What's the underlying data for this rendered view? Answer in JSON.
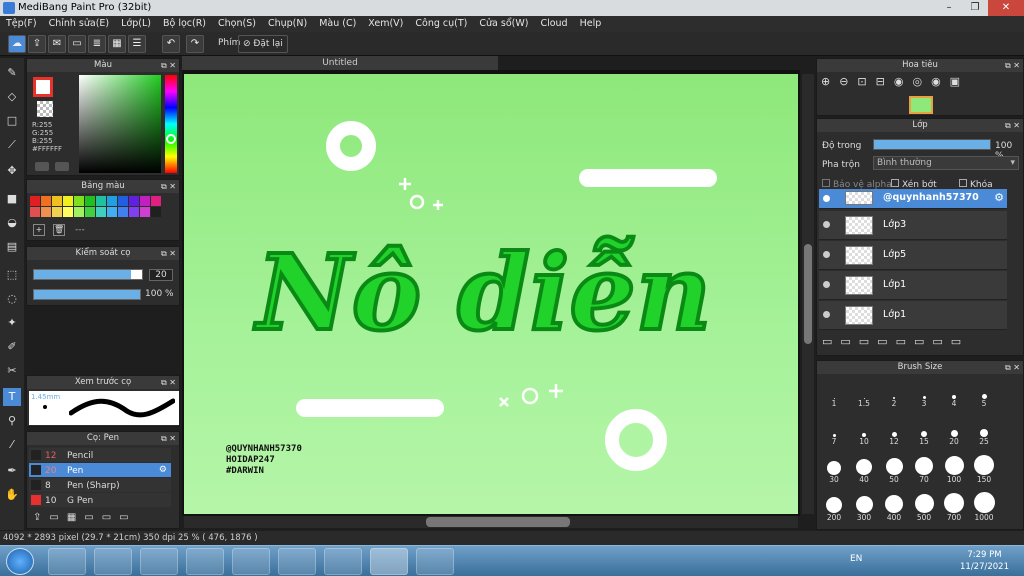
{
  "app": {
    "title": "MediBang Paint Pro (32bit)"
  },
  "window": {
    "min": "–",
    "max": "❐",
    "close": "✕"
  },
  "menu": [
    "Tệp(F)",
    "Chỉnh sửa(E)",
    "Lớp(L)",
    "Bộ lọc(R)",
    "Chọn(S)",
    "Chụp(N)",
    "Màu (C)",
    "Xem(V)",
    "Công cụ(T)",
    "Cửa sổ(W)",
    "Cloud",
    "Help"
  ],
  "toolbar": {
    "shortcut_label": "Phím",
    "reset_label": "Đặt lại"
  },
  "document": {
    "tab": "Untitled"
  },
  "color_panel": {
    "title": "Màu",
    "r": "R:255",
    "g": "G:255",
    "b": "B:255",
    "hex": "#FFFFFF",
    "primary": "#e8322a",
    "secondary": "#ffffff"
  },
  "palette_panel": {
    "title": "Bảng màu",
    "more": "---"
  },
  "brush_control": {
    "title": "Kiểm soát cọ",
    "size": "20",
    "opacity": "100 %",
    "size_fraction": 0.9,
    "opacity_fraction": 1.0
  },
  "brush_preview": {
    "title": "Xem trước cọ",
    "size_label": "1.45mm"
  },
  "brush_list": {
    "title": "Cọ: Pen",
    "items": [
      {
        "size": "12",
        "name": "Pencil"
      },
      {
        "size": "20",
        "name": "Pen"
      },
      {
        "size": "8",
        "name": "Pen (Sharp)"
      },
      {
        "size": "10",
        "name": "G Pen"
      }
    ]
  },
  "navigator": {
    "title": "Hoa tiêu"
  },
  "layer_panel": {
    "title": "Lớp",
    "opacity_label": "Độ trong",
    "opacity_value": "100 %",
    "blend_label": "Pha trộn",
    "blend_value": "Bình thường",
    "protect_alpha": "Bảo vệ alpha",
    "clipping": "Xén bớt",
    "lock": "Khóa",
    "layers": [
      "@quynhanh57370",
      "Lớp3",
      "Lớp5",
      "Lớp1",
      "Lớp1"
    ]
  },
  "brush_size_panel": {
    "title": "Brush Size",
    "sizes": [
      "1",
      "1.5",
      "2",
      "3",
      "4",
      "5",
      "7",
      "10",
      "12",
      "15",
      "20",
      "25",
      "30",
      "40",
      "50",
      "70",
      "100",
      "150",
      "200",
      "300",
      "400",
      "500",
      "700",
      "1000"
    ]
  },
  "canvas_art": {
    "main_text": "Nô diễn",
    "credits": [
      "@QUYNHANH57370",
      "HOIDAP247",
      "#DARWIN"
    ]
  },
  "status": {
    "dimensions": "4092 * 2893 pixel",
    "physical": "(29.7 * 21cm)",
    "dpi": "350 dpi",
    "zoom": "25 %",
    "cursor": "( 476, 1876 )"
  },
  "taskbar": {
    "lang": "EN",
    "time": "7:29 PM",
    "date": "11/27/2021"
  }
}
